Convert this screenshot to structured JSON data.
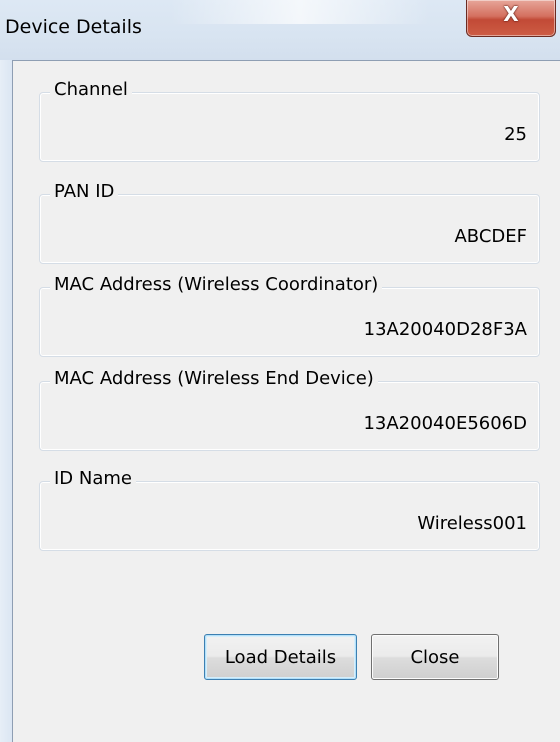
{
  "window": {
    "title": "Device Details",
    "close_glyph": "X"
  },
  "groups": [
    {
      "label": "Channel",
      "value": "25"
    },
    {
      "label": "PAN ID",
      "value": "ABCDEF"
    },
    {
      "label": "MAC Address (Wireless Coordinator)",
      "value": "13A20040D28F3A"
    },
    {
      "label": "MAC Address (Wireless End Device)",
      "value": "13A20040E5606D"
    },
    {
      "label": "ID Name",
      "value": "Wireless001"
    }
  ],
  "buttons": {
    "load_details": "Load Details",
    "close": "Close"
  },
  "colors": {
    "title_bar": "#d8e4f1",
    "client_bg": "#f0f0f0",
    "close_button_red": "#c24a36",
    "default_button_border": "#3c7fb1"
  }
}
